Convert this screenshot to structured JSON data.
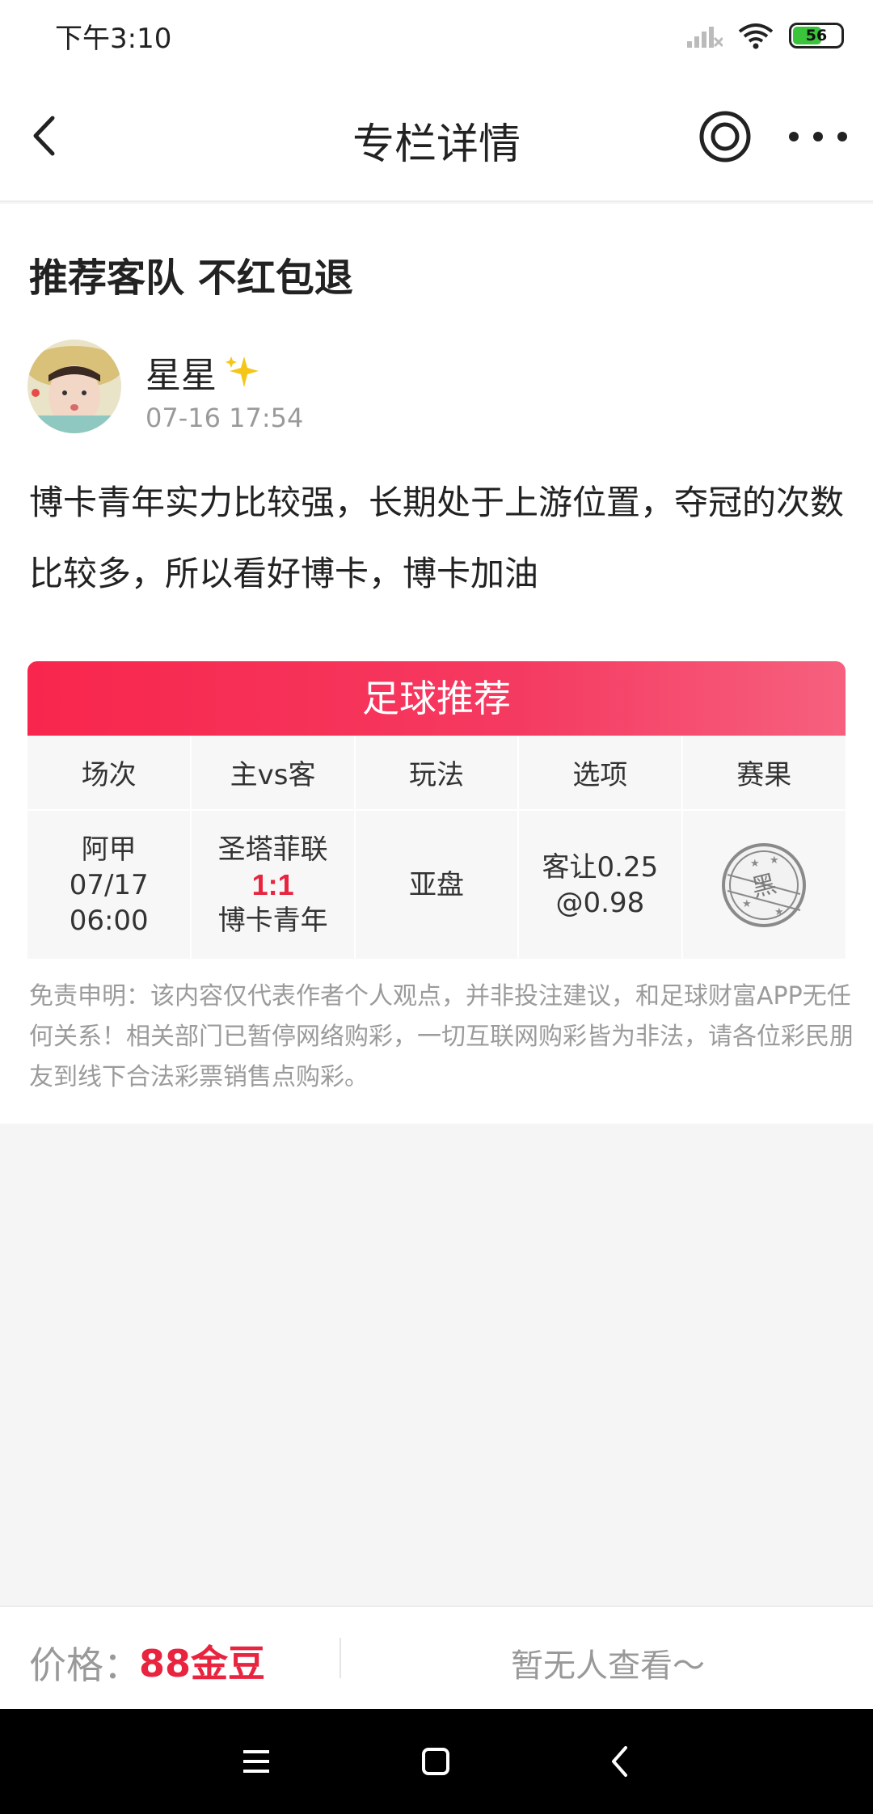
{
  "status_bar": {
    "time": "下午3:10",
    "battery": "56",
    "battery_level": 0.56
  },
  "nav": {
    "title": "专栏详情"
  },
  "article": {
    "title": "推荐客队 不红包退",
    "author": "星星",
    "time": "07-16 17:54",
    "body": "博卡青年实力比较强，长期处于上游位置，夺冠的次数比较多，所以看好博卡，博卡加油"
  },
  "recommendation": {
    "header": "足球推荐",
    "columns": [
      "场次",
      "主vs客",
      "玩法",
      "选项",
      "赛果"
    ],
    "row": {
      "league": "阿甲",
      "date": "07/17",
      "time": "06:00",
      "home": "圣塔菲联",
      "score": "1:1",
      "away": "博卡青年",
      "play": "亚盘",
      "option_line1": "客让0.25",
      "option_line2": "@0.98",
      "result_stamp": "黑"
    }
  },
  "disclaimer": "免责申明：该内容仅代表作者个人观点，并非投注建议，和足球财富APP无任何关系！相关部门已暂停网络购彩，一切互联网购彩皆为非法，请各位彩民朋友到线下合法彩票销售点购彩。",
  "bottom": {
    "price_label": "价格：",
    "price_value": "88金豆",
    "viewers": "暂无人查看～"
  },
  "icons": {
    "back": "chevron-left-icon",
    "target": "target-icon",
    "more": "more-dots-icon",
    "menu": "menu-icon",
    "home": "home-square-icon",
    "sys_back": "sys-back-icon"
  },
  "colors": {
    "accent": "#e8243f",
    "header_start": "#f8264d",
    "header_end": "#f6607e"
  }
}
